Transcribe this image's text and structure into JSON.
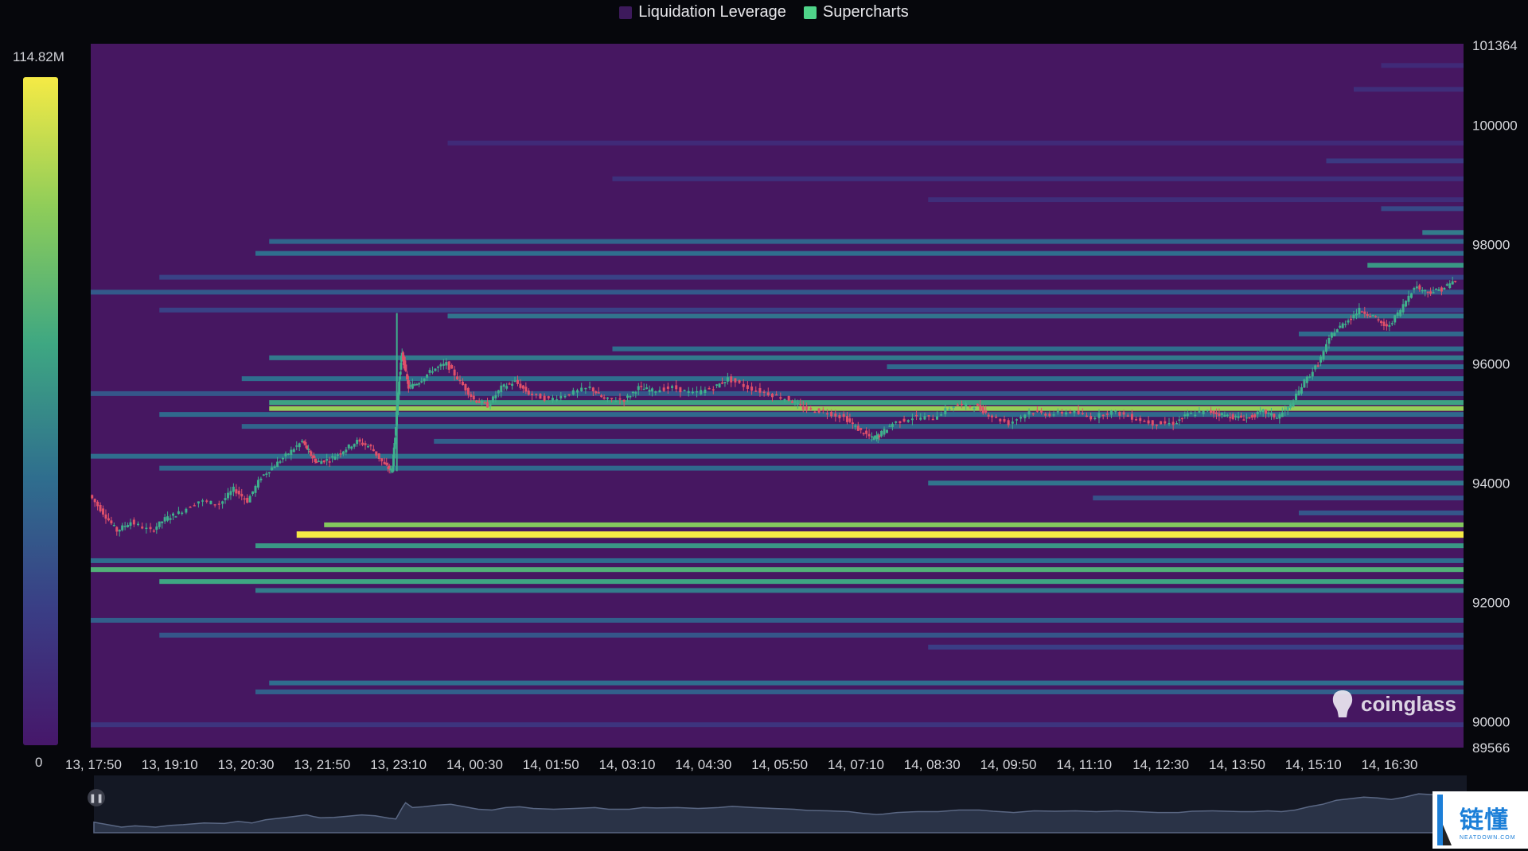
{
  "legend": [
    {
      "label": "Liquidation Leverage",
      "color": "#3d1a5c"
    },
    {
      "label": "Supercharts",
      "color": "#4fd48a"
    }
  ],
  "scale": {
    "max_label": "114.82M",
    "min_label": "0",
    "colors": [
      "#f5ea45",
      "#8ccc5a",
      "#3ea782",
      "#2f6e8e",
      "#3a3d85",
      "#46176a"
    ]
  },
  "watermark": "coinglass",
  "badge": {
    "main": "链懂",
    "sub": "NEATDOWN.COM"
  },
  "chart_data": {
    "type": "heatmap",
    "y_axis": {
      "min": 89566,
      "max": 101364,
      "tick_labels": [
        "101364",
        "100000",
        "98000",
        "96000",
        "94000",
        "92000",
        "90000",
        "89566"
      ],
      "tick_values": [
        101364,
        100000,
        98000,
        96000,
        94000,
        92000,
        90000,
        89566
      ]
    },
    "x_axis": {
      "tick_labels": [
        "13, 17:50",
        "13, 19:10",
        "13, 20:30",
        "13, 21:50",
        "13, 23:10",
        "14, 00:30",
        "14, 01:50",
        "14, 03:10",
        "14, 04:30",
        "14, 05:50",
        "14, 07:10",
        "14, 08:30",
        "14, 09:50",
        "14, 11:10",
        "14, 12:30",
        "14, 13:50",
        "14, 15:10",
        "14, 16:30"
      ]
    },
    "liquidation_bands": [
      {
        "price": 101000,
        "start": 0.94,
        "intensity": 0.1
      },
      {
        "price": 100600,
        "start": 0.92,
        "intensity": 0.12
      },
      {
        "price": 99700,
        "start": 0.26,
        "intensity": 0.1
      },
      {
        "price": 99400,
        "start": 0.9,
        "intensity": 0.18
      },
      {
        "price": 99100,
        "start": 0.38,
        "intensity": 0.13
      },
      {
        "price": 98750,
        "start": 0.61,
        "intensity": 0.12
      },
      {
        "price": 98600,
        "start": 0.94,
        "intensity": 0.25
      },
      {
        "price": 98200,
        "start": 0.97,
        "intensity": 0.45
      },
      {
        "price": 98050,
        "start": 0.13,
        "intensity": 0.36
      },
      {
        "price": 97850,
        "start": 0.12,
        "intensity": 0.4
      },
      {
        "price": 97650,
        "start": 0.93,
        "intensity": 0.55
      },
      {
        "price": 97450,
        "start": 0.05,
        "intensity": 0.22
      },
      {
        "price": 97200,
        "start": 0.0,
        "intensity": 0.32
      },
      {
        "price": 96900,
        "start": 0.05,
        "intensity": 0.22
      },
      {
        "price": 96800,
        "start": 0.26,
        "intensity": 0.42
      },
      {
        "price": 96500,
        "start": 0.88,
        "intensity": 0.38
      },
      {
        "price": 96250,
        "start": 0.38,
        "intensity": 0.4
      },
      {
        "price": 96100,
        "start": 0.13,
        "intensity": 0.44
      },
      {
        "price": 95950,
        "start": 0.58,
        "intensity": 0.38
      },
      {
        "price": 95750,
        "start": 0.11,
        "intensity": 0.4
      },
      {
        "price": 95500,
        "start": 0.0,
        "intensity": 0.3
      },
      {
        "price": 95350,
        "start": 0.13,
        "intensity": 0.58
      },
      {
        "price": 95250,
        "start": 0.13,
        "intensity": 0.82
      },
      {
        "price": 95150,
        "start": 0.05,
        "intensity": 0.38
      },
      {
        "price": 94950,
        "start": 0.11,
        "intensity": 0.36
      },
      {
        "price": 94700,
        "start": 0.25,
        "intensity": 0.34
      },
      {
        "price": 94450,
        "start": 0.0,
        "intensity": 0.4
      },
      {
        "price": 94250,
        "start": 0.05,
        "intensity": 0.38
      },
      {
        "price": 94000,
        "start": 0.61,
        "intensity": 0.42
      },
      {
        "price": 93750,
        "start": 0.73,
        "intensity": 0.28
      },
      {
        "price": 93500,
        "start": 0.88,
        "intensity": 0.3
      },
      {
        "price": 93300,
        "start": 0.17,
        "intensity": 0.78
      },
      {
        "price": 93150,
        "start": 0.15,
        "intensity": 1.0
      },
      {
        "price": 92950,
        "start": 0.12,
        "intensity": 0.55
      },
      {
        "price": 92700,
        "start": 0.0,
        "intensity": 0.4
      },
      {
        "price": 92550,
        "start": 0.0,
        "intensity": 0.65
      },
      {
        "price": 92350,
        "start": 0.05,
        "intensity": 0.6
      },
      {
        "price": 92200,
        "start": 0.12,
        "intensity": 0.45
      },
      {
        "price": 91700,
        "start": 0.0,
        "intensity": 0.34
      },
      {
        "price": 91450,
        "start": 0.05,
        "intensity": 0.3
      },
      {
        "price": 91250,
        "start": 0.61,
        "intensity": 0.2
      },
      {
        "price": 90650,
        "start": 0.13,
        "intensity": 0.4
      },
      {
        "price": 90500,
        "start": 0.12,
        "intensity": 0.34
      },
      {
        "price": 89950,
        "start": 0.0,
        "intensity": 0.15
      }
    ],
    "price_path": [
      {
        "x": 0.0,
        "price": 93800
      },
      {
        "x": 0.01,
        "price": 93500
      },
      {
        "x": 0.02,
        "price": 93200
      },
      {
        "x": 0.03,
        "price": 93350
      },
      {
        "x": 0.045,
        "price": 93200
      },
      {
        "x": 0.055,
        "price": 93400
      },
      {
        "x": 0.065,
        "price": 93500
      },
      {
        "x": 0.08,
        "price": 93700
      },
      {
        "x": 0.095,
        "price": 93650
      },
      {
        "x": 0.105,
        "price": 93900
      },
      {
        "x": 0.115,
        "price": 93700
      },
      {
        "x": 0.125,
        "price": 94100
      },
      {
        "x": 0.135,
        "price": 94300
      },
      {
        "x": 0.145,
        "price": 94500
      },
      {
        "x": 0.155,
        "price": 94700
      },
      {
        "x": 0.16,
        "price": 94500
      },
      {
        "x": 0.165,
        "price": 94350
      },
      {
        "x": 0.175,
        "price": 94400
      },
      {
        "x": 0.185,
        "price": 94550
      },
      {
        "x": 0.195,
        "price": 94700
      },
      {
        "x": 0.205,
        "price": 94600
      },
      {
        "x": 0.215,
        "price": 94300
      },
      {
        "x": 0.22,
        "price": 94200
      },
      {
        "x": 0.222,
        "price": 94800
      },
      {
        "x": 0.225,
        "price": 95700
      },
      {
        "x": 0.227,
        "price": 96200
      },
      {
        "x": 0.232,
        "price": 95600
      },
      {
        "x": 0.24,
        "price": 95700
      },
      {
        "x": 0.25,
        "price": 95900
      },
      {
        "x": 0.26,
        "price": 96000
      },
      {
        "x": 0.27,
        "price": 95700
      },
      {
        "x": 0.28,
        "price": 95400
      },
      {
        "x": 0.29,
        "price": 95300
      },
      {
        "x": 0.3,
        "price": 95600
      },
      {
        "x": 0.31,
        "price": 95700
      },
      {
        "x": 0.32,
        "price": 95500
      },
      {
        "x": 0.335,
        "price": 95400
      },
      {
        "x": 0.35,
        "price": 95500
      },
      {
        "x": 0.365,
        "price": 95600
      },
      {
        "x": 0.375,
        "price": 95400
      },
      {
        "x": 0.39,
        "price": 95400
      },
      {
        "x": 0.4,
        "price": 95600
      },
      {
        "x": 0.41,
        "price": 95550
      },
      {
        "x": 0.425,
        "price": 95600
      },
      {
        "x": 0.44,
        "price": 95500
      },
      {
        "x": 0.455,
        "price": 95600
      },
      {
        "x": 0.465,
        "price": 95750
      },
      {
        "x": 0.48,
        "price": 95600
      },
      {
        "x": 0.495,
        "price": 95500
      },
      {
        "x": 0.51,
        "price": 95400
      },
      {
        "x": 0.52,
        "price": 95250
      },
      {
        "x": 0.535,
        "price": 95200
      },
      {
        "x": 0.55,
        "price": 95100
      },
      {
        "x": 0.56,
        "price": 94900
      },
      {
        "x": 0.57,
        "price": 94750
      },
      {
        "x": 0.575,
        "price": 94800
      },
      {
        "x": 0.585,
        "price": 95000
      },
      {
        "x": 0.6,
        "price": 95100
      },
      {
        "x": 0.615,
        "price": 95100
      },
      {
        "x": 0.63,
        "price": 95300
      },
      {
        "x": 0.645,
        "price": 95300
      },
      {
        "x": 0.655,
        "price": 95150
      },
      {
        "x": 0.67,
        "price": 95000
      },
      {
        "x": 0.685,
        "price": 95200
      },
      {
        "x": 0.7,
        "price": 95150
      },
      {
        "x": 0.715,
        "price": 95200
      },
      {
        "x": 0.73,
        "price": 95100
      },
      {
        "x": 0.745,
        "price": 95200
      },
      {
        "x": 0.76,
        "price": 95100
      },
      {
        "x": 0.775,
        "price": 95000
      },
      {
        "x": 0.79,
        "price": 95000
      },
      {
        "x": 0.8,
        "price": 95150
      },
      {
        "x": 0.815,
        "price": 95200
      },
      {
        "x": 0.825,
        "price": 95150
      },
      {
        "x": 0.835,
        "price": 95100
      },
      {
        "x": 0.845,
        "price": 95100
      },
      {
        "x": 0.855,
        "price": 95200
      },
      {
        "x": 0.865,
        "price": 95100
      },
      {
        "x": 0.875,
        "price": 95300
      },
      {
        "x": 0.885,
        "price": 95700
      },
      {
        "x": 0.895,
        "price": 96000
      },
      {
        "x": 0.905,
        "price": 96500
      },
      {
        "x": 0.915,
        "price": 96700
      },
      {
        "x": 0.925,
        "price": 96900
      },
      {
        "x": 0.935,
        "price": 96800
      },
      {
        "x": 0.945,
        "price": 96600
      },
      {
        "x": 0.955,
        "price": 96900
      },
      {
        "x": 0.965,
        "price": 97300
      },
      {
        "x": 0.975,
        "price": 97200
      },
      {
        "x": 0.985,
        "price": 97250
      },
      {
        "x": 0.995,
        "price": 97400
      }
    ]
  }
}
